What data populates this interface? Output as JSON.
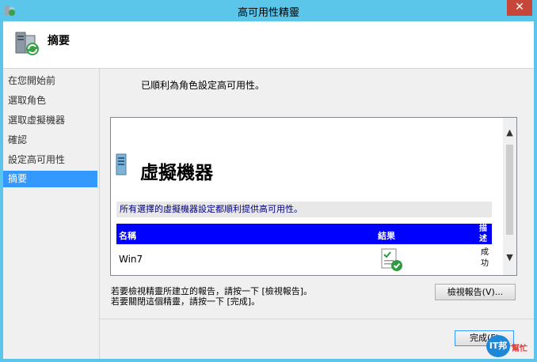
{
  "window": {
    "title": "高可用性精靈",
    "close_glyph": "✕"
  },
  "header": {
    "title": "摘要"
  },
  "sidebar": {
    "items": [
      {
        "label": "在您開始前",
        "active": false
      },
      {
        "label": "選取角色",
        "active": false
      },
      {
        "label": "選取虛擬機器",
        "active": false
      },
      {
        "label": "確認",
        "active": false
      },
      {
        "label": "設定高可用性",
        "active": false
      },
      {
        "label": "摘要",
        "active": true
      }
    ]
  },
  "main": {
    "success_message": "已順利為角色設定高可用性。",
    "report": {
      "heading": "虛擬機器",
      "description": "所有選擇的虛擬機器設定都順利提供高可用性。",
      "columns": [
        "名稱",
        "結果",
        "描述"
      ],
      "rows": [
        {
          "name": "Win7",
          "result_icon": "success-report-icon",
          "description": "成功"
        }
      ]
    },
    "hint_line1": "若要檢視精靈所建立的報告，請按一下 [檢視報告]。",
    "hint_line2": "若要關閉這個精靈，請按一下 [完成]。",
    "view_report_label": "檢視報告(V)...",
    "finish_label": "完成(F)"
  },
  "watermark": {
    "badge": "IT邦",
    "text": "幫忙"
  },
  "colors": {
    "titlebar": "#5bc6ea",
    "selection": "#3399ff",
    "table_header": "#0000ff",
    "close": "#c7463a"
  }
}
